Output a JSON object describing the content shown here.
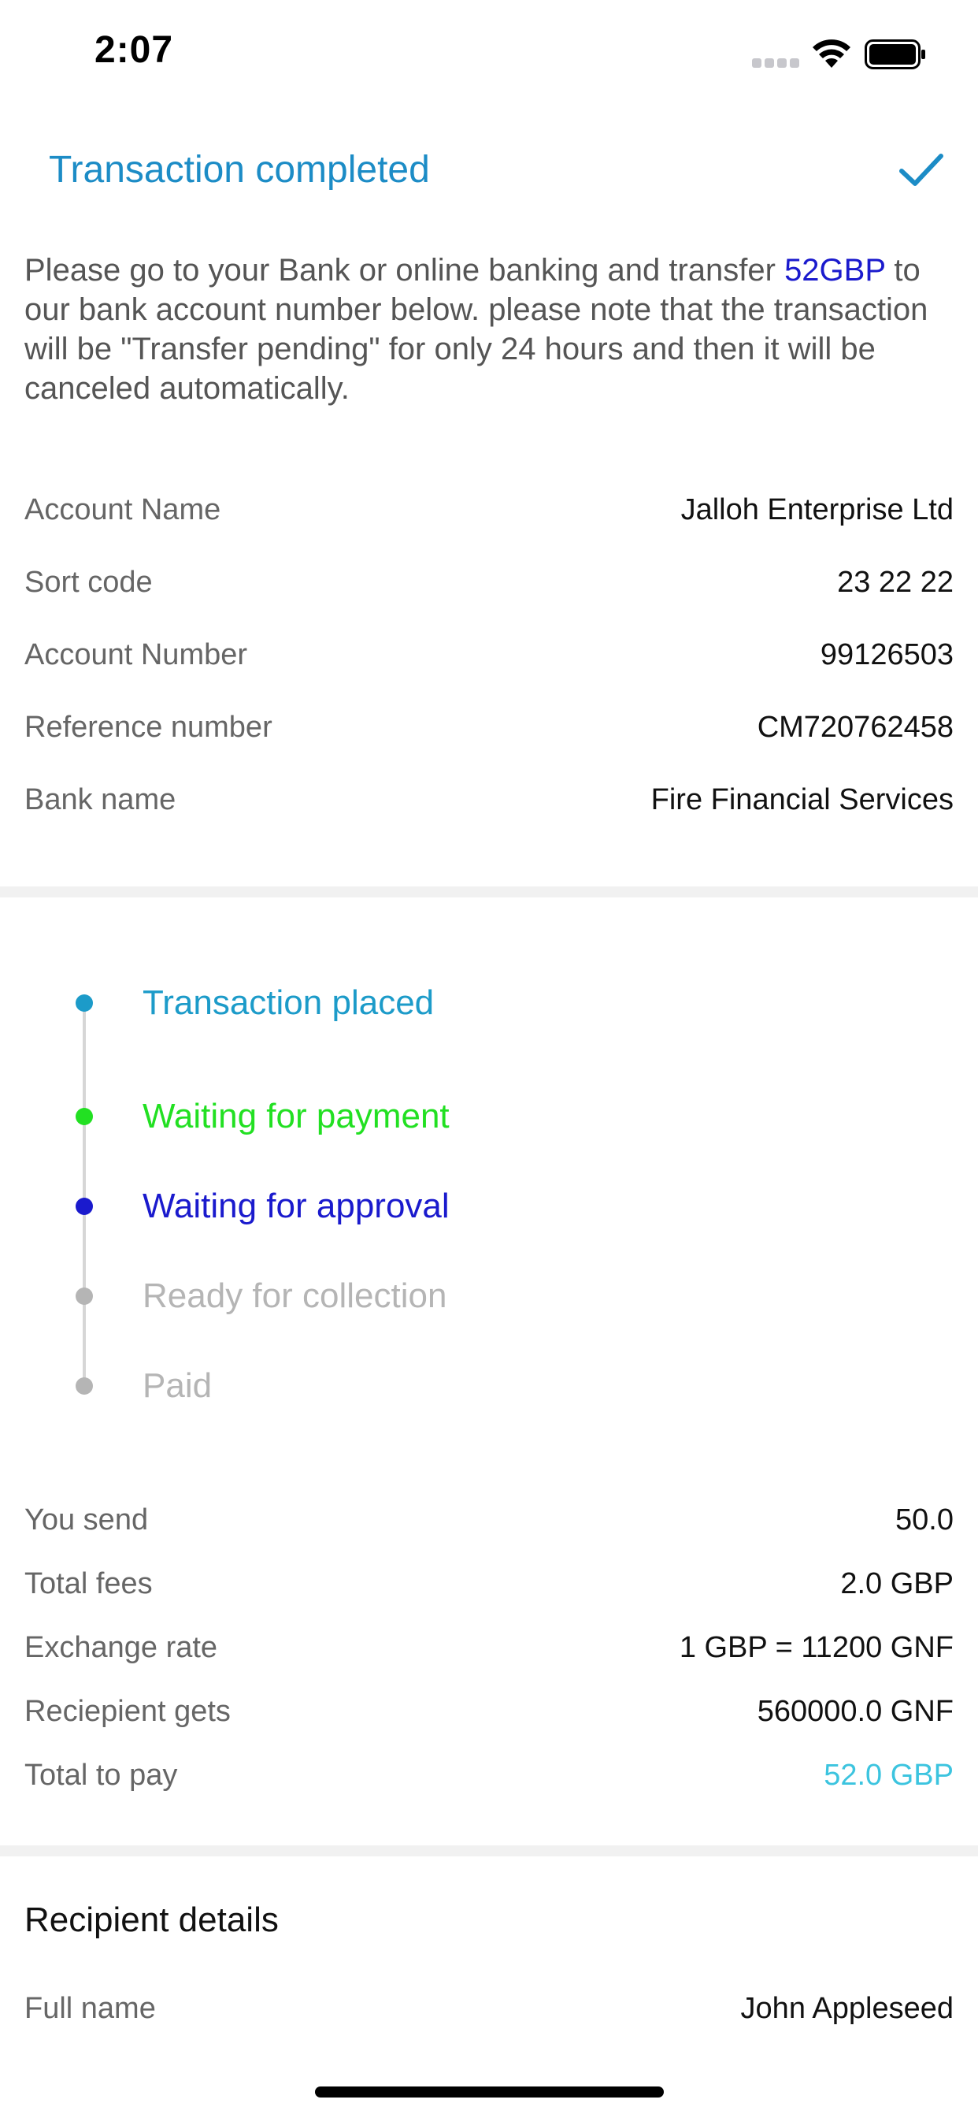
{
  "status_bar": {
    "time": "2:07"
  },
  "header": {
    "title": "Transaction completed"
  },
  "instructions": {
    "before": "Please go to your Bank or online banking and transfer ",
    "amount": "52GBP",
    "after": " to our bank account number below. please note that the transaction will be \"Transfer pending\" for only 24 hours and then it will be canceled automatically."
  },
  "bank_details": [
    {
      "label": "Account Name",
      "value": "Jalloh Enterprise Ltd"
    },
    {
      "label": "Sort code",
      "value": "23 22 22"
    },
    {
      "label": "Account Number",
      "value": "99126503"
    },
    {
      "label": "Reference number",
      "value": "CM720762458"
    },
    {
      "label": "Bank name",
      "value": "Fire Financial Services"
    }
  ],
  "timeline": [
    {
      "label": "Transaction placed",
      "color": "#1c9bc9",
      "dot": "#1c9bc9"
    },
    {
      "label": "Waiting for payment",
      "color": "#22e022",
      "dot": "#22e022"
    },
    {
      "label": "Waiting for approval",
      "color": "#1a1acd",
      "dot": "#1a1acd"
    },
    {
      "label": "Ready for collection",
      "color": "#b5b5b5",
      "dot": "#b5b5b5"
    },
    {
      "label": "Paid",
      "color": "#b5b5b5",
      "dot": "#b5b5b5"
    }
  ],
  "summary": [
    {
      "label": "You send",
      "value": "50.0"
    },
    {
      "label": "Total fees",
      "value": "2.0 GBP"
    },
    {
      "label": "Exchange rate",
      "value": "1 GBP = 11200 GNF"
    },
    {
      "label": "Reciepient gets",
      "value": "560000.0 GNF"
    },
    {
      "label": "Total to pay",
      "value": "52.0 GBP",
      "color": "#3cc4df"
    }
  ],
  "recipient": {
    "title": "Recipient details",
    "rows": [
      {
        "label": "Full name",
        "value": "John Appleseed"
      }
    ]
  },
  "colors": {
    "accent": "#1c8cc6",
    "amount_highlight": "#1a1acd",
    "total_to_pay": "#3cc4df"
  }
}
